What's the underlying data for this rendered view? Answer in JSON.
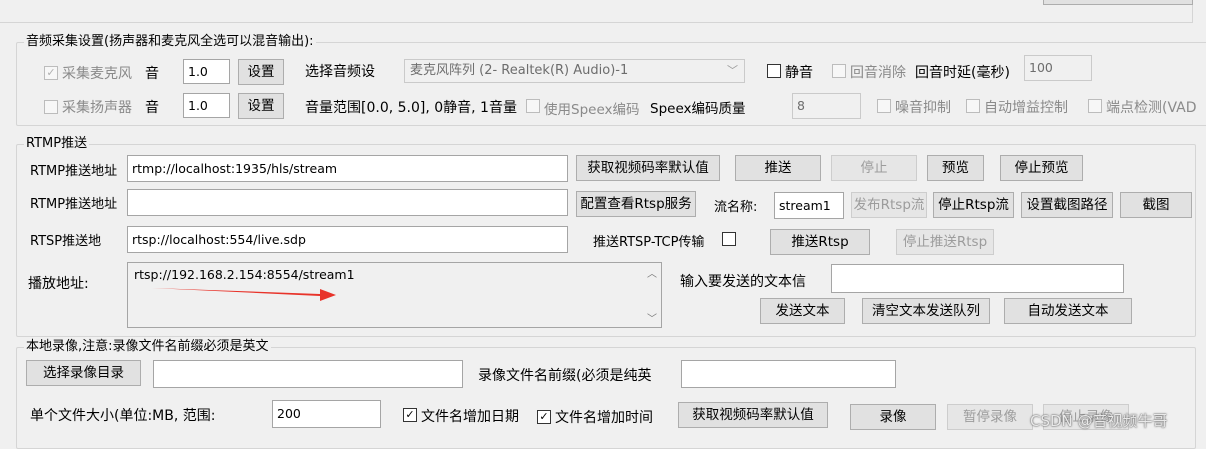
{
  "audio": {
    "title": "音频采集设置(扬声器和麦克风全选可以混音输出):",
    "mic_label": "采集麦克风",
    "mic_vol_label": "音",
    "mic_vol_value": "1.0",
    "set_button": "设置",
    "speaker_label": "采集扬声器",
    "speaker_vol_label": "音",
    "speaker_vol_value": "1.0",
    "select_device_label": "选择音频设",
    "device_value": "麦克风阵列 (2- Realtek(R) Audio)-1",
    "mute_label": "静音",
    "echo_cancel_label": "回音消除",
    "echo_delay_label": "回音时延(毫秒)",
    "echo_delay_value": "100",
    "volume_range_label": "音量范围[0.0, 5.0], 0静音, 1音量",
    "use_speex_label": "使用Speex编码",
    "speex_quality_label": "Speex编码质量",
    "speex_quality_value": "8",
    "noise_label": "噪音抑制",
    "agc_label": "自动增益控制",
    "vad_label": "端点检测(VAD"
  },
  "rtmp": {
    "title": "RTMP推送",
    "url_label": "RTMP推送地址",
    "url_value": "rtmp://localhost:1935/hls/stream",
    "get_bitrate_button": "获取视频码率默认值",
    "push_button": "推送",
    "stop_button": "停止",
    "preview_button": "预览",
    "stop_preview_button": "停止预览",
    "url2_label": "RTMP推送地址",
    "url2_value": "",
    "rtsp_config_button": "配置查看Rtsp服务",
    "stream_name_label": "流名称:",
    "stream_name_value": "stream1",
    "publish_rtsp_button": "发布Rtsp流",
    "stop_rtsp_stream_button": "停止Rtsp流",
    "snapshot_path_button": "设置截图路径",
    "snapshot_button": "截图",
    "rtsp_url_label": "RTSP推送地",
    "rtsp_url_value": "rtsp://localhost:554/live.sdp",
    "rtsp_tcp_label": "推送RTSP-TCP传输",
    "push_rtsp_button": "推送Rtsp",
    "stop_push_rtsp_button": "停止推送Rtsp",
    "play_url_label": "播放地址:",
    "play_url_value": "rtsp://192.168.2.154:8554/stream1",
    "send_text_label": "输入要发送的文本信",
    "send_text_value": "",
    "send_text_button": "发送文本",
    "clear_queue_button": "清空文本发送队列",
    "auto_send_button": "自动发送文本"
  },
  "record": {
    "title": "本地录像,注意:录像文件名前缀必须是英文",
    "select_dir_button": "选择录像目录",
    "dir_value": "",
    "prefix_label": "录像文件名前缀(必须是纯英",
    "prefix_value": "",
    "file_size_label": "单个文件大小(单位:MB, 范围:",
    "file_size_value": "200",
    "add_date_label": "文件名增加日期",
    "add_time_label": "文件名增加时间",
    "get_bitrate_button": "获取视频码率默认值",
    "record_button": "录像",
    "pause_button": "暂停录像",
    "stop_button": "停止录像"
  },
  "watermark": "CSDN @音视频牛哥",
  "colors": {
    "arrow": "#e8332a"
  }
}
